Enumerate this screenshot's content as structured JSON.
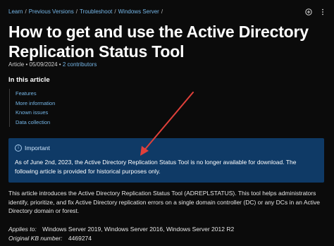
{
  "breadcrumb": {
    "items": [
      "Learn",
      "Previous Versions",
      "Troubleshoot",
      "Windows Server"
    ],
    "separator": "/"
  },
  "top_icons": [
    "add-circle-icon",
    "more-icon"
  ],
  "title": "How to get and use the Active Directory Replication Status Tool",
  "meta": {
    "type": "Article",
    "separator": "•",
    "date": "05/09/2024",
    "contributors": "2 contributors"
  },
  "toc": {
    "heading": "In this article",
    "items": [
      "Features",
      "More information",
      "Known issues",
      "Data collection"
    ]
  },
  "callout": {
    "title": "Important",
    "body": "As of June 2nd, 2023, the Active Directory Replication Status Tool is no longer available for download. The following article is provided for historical purposes only."
  },
  "intro": "This article introduces the Active Directory Replication Status Tool (ADREPLSTATUS). This tool helps administrators identify, prioritize, and fix Active Directory replication errors on a single domain controller (DC) or any DCs in an Active Directory domain or forest.",
  "applies_to": {
    "label": "Applies to:",
    "value": "Windows Server 2019, Windows Server 2016, Windows Server 2012 R2"
  },
  "kb": {
    "label": "Original KB number:",
    "value": "4469274"
  },
  "colors": {
    "background": "#0b0b0b",
    "link": "#75b6e7",
    "callout": "#0f3a66",
    "annotation": "#e0403a"
  }
}
